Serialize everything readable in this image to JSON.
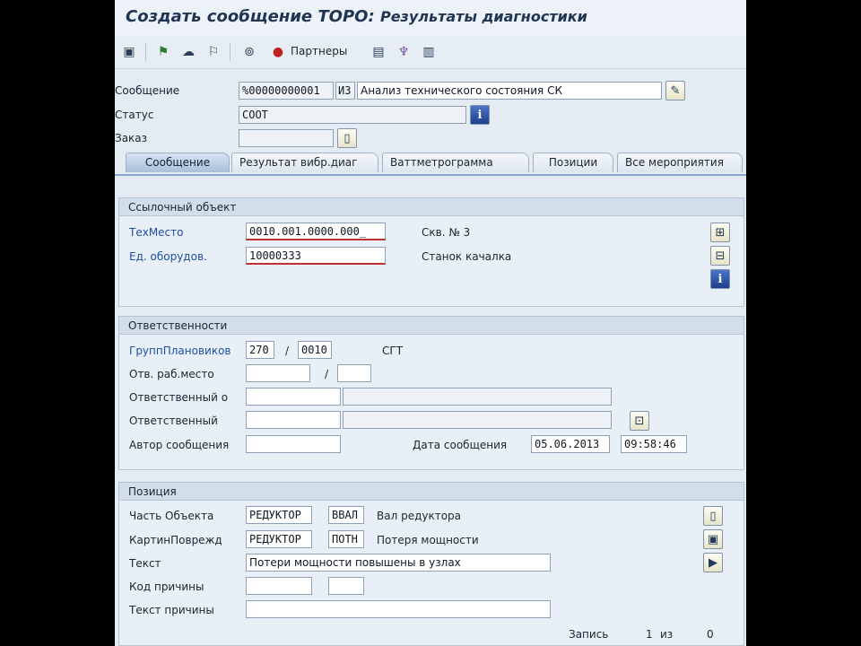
{
  "window": {
    "title_main": "Создать сообщение ТОРО:",
    "title_sub": "Результаты диагностики"
  },
  "toolbar": {
    "partners_label": "Партнеры"
  },
  "header": {
    "message_label": "Сообщение",
    "message_number": "%00000000001",
    "message_type": "ИЗ",
    "message_text": "Анализ технического состояния СК",
    "status_label": "Статус",
    "status_value": "СООТ",
    "order_label": "Заказ",
    "order_value": ""
  },
  "tabs": [
    {
      "label": "Сообщение",
      "active": true
    },
    {
      "label": "Результат вибр.диаг"
    },
    {
      "label": "Ваттметрограмма"
    },
    {
      "label": "Позиции"
    },
    {
      "label": "Все мероприятия"
    }
  ],
  "reference": {
    "title": "Ссылочный объект",
    "techplace_label": "ТехМесто",
    "techplace_value": "0010.001.0000.000_",
    "techplace_desc": "Скв. № 3",
    "equipment_label": "Ед. оборудов.",
    "equipment_value": "10000333",
    "equipment_desc": "Станок качалка"
  },
  "responsibility": {
    "title": "Ответственности",
    "planner_label": "ГруппПлановиков",
    "planner_group": "270",
    "planner_plant": "0010",
    "planner_desc": "СГТ",
    "workcenter_label": "Отв. раб.место",
    "workcenter_value": "",
    "workcenter_plant": "",
    "resp_o_label": "Ответственный о",
    "resp_label": "Ответственный",
    "author_label": "Автор сообщения",
    "author_value": "",
    "date_label": "Дата сообщения",
    "date_value": "05.06.2013",
    "time_value": "09:58:46"
  },
  "position": {
    "title": "Позиция",
    "object_part_label": "Часть Объекта",
    "object_part_code": "РЕДУКТОР",
    "object_part_subcode": "ВВАЛ",
    "object_part_desc": "Вал редуктора",
    "damage_label": "КартинПоврежд",
    "damage_code": "РЕДУКТОР",
    "damage_subcode": "ПОТН",
    "damage_desc": "Потеря мощности",
    "text_label": "Текст",
    "text_value": "Потери мощности повышены в узлах",
    "cause_code_label": "Код причины",
    "cause_text_label": "Текст причины",
    "record_label": "Запись",
    "record_current": "1",
    "record_of": "из",
    "record_total": "0"
  }
}
